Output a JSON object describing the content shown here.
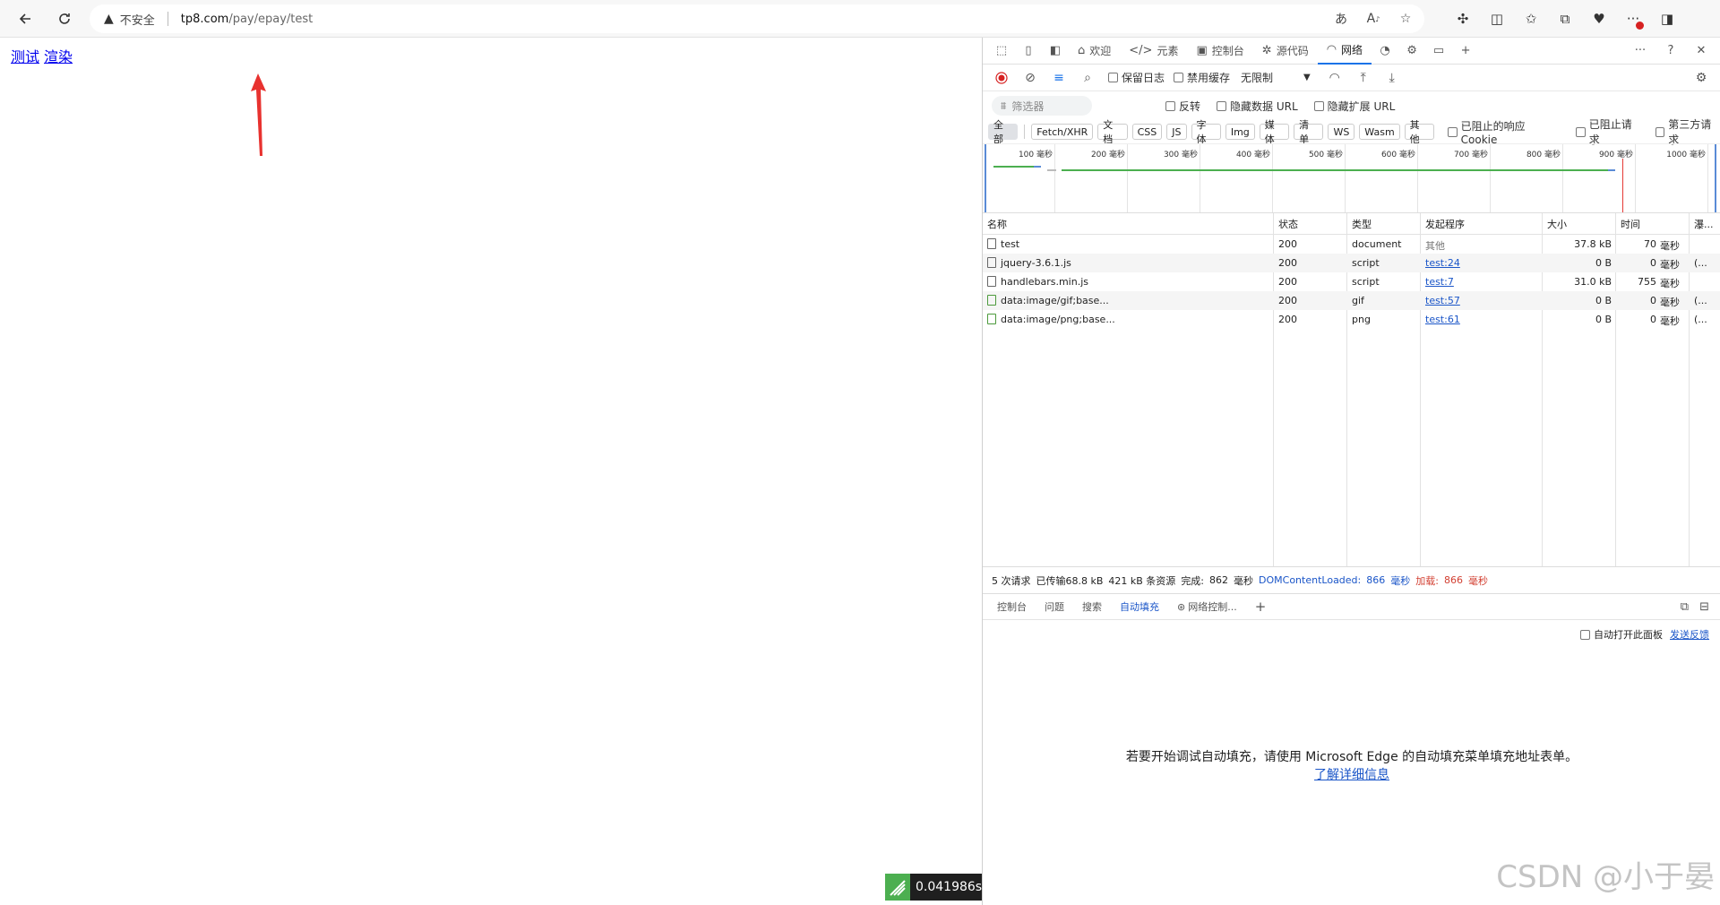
{
  "browser": {
    "insecure_label": "不安全",
    "url_host": "tp8.com",
    "url_path": "/pay/epay/test"
  },
  "page": {
    "links": [
      "测试",
      "渲染"
    ],
    "timer": "0.041986s"
  },
  "devtools": {
    "tabs": [
      {
        "label": "欢迎",
        "icon": "home-icon"
      },
      {
        "label": "元素",
        "icon": "code-icon"
      },
      {
        "label": "控制台",
        "icon": "console-icon"
      },
      {
        "label": "源代码",
        "icon": "bug-icon"
      },
      {
        "label": "网络",
        "icon": "wifi-icon",
        "active": true
      }
    ],
    "network_toolbar": {
      "preserve_log": "保留日志",
      "disable_cache": "禁用缓存",
      "throttle": "无限制"
    },
    "filter": {
      "placeholder": "筛选器",
      "invert": "反转",
      "hide_data_url": "隐藏数据 URL",
      "hide_ext_url": "隐藏扩展 URL"
    },
    "type_filters": [
      "全部",
      "Fetch/XHR",
      "文档",
      "CSS",
      "JS",
      "字体",
      "Img",
      "媒体",
      "清单",
      "WS",
      "Wasm",
      "其他"
    ],
    "type_checks": [
      "已阻止的响应 Cookie",
      "已阻止请求",
      "第三方请求"
    ],
    "overview_ticks": [
      "100 毫秒",
      "200 毫秒",
      "300 毫秒",
      "400 毫秒",
      "500 毫秒",
      "600 毫秒",
      "700 毫秒",
      "800 毫秒",
      "900 毫秒",
      "1000 毫秒"
    ],
    "columns": [
      "名称",
      "状态",
      "类型",
      "发起程序",
      "大小",
      "时间",
      "瀑..."
    ],
    "requests": [
      {
        "name": "test",
        "status": "200",
        "type": "document",
        "initiator": "其他",
        "initiator_link": false,
        "size": "37.8 kB",
        "time": "70",
        "unit": "毫秒",
        "extra": "",
        "icon": "doc"
      },
      {
        "name": "jquery-3.6.1.js",
        "status": "200",
        "type": "script",
        "initiator": "test:24",
        "initiator_link": true,
        "size": "0 B",
        "time": "0",
        "unit": "毫秒",
        "extra": "(...",
        "icon": "script"
      },
      {
        "name": "handlebars.min.js",
        "status": "200",
        "type": "script",
        "initiator": "test:7",
        "initiator_link": true,
        "size": "31.0 kB",
        "time": "755",
        "unit": "毫秒",
        "extra": "",
        "icon": "script"
      },
      {
        "name": "data:image/gif;base...",
        "status": "200",
        "type": "gif",
        "initiator": "test:57",
        "initiator_link": true,
        "size": "0 B",
        "time": "0",
        "unit": "毫秒",
        "extra": "(...",
        "icon": "img"
      },
      {
        "name": "data:image/png;base...",
        "status": "200",
        "type": "png",
        "initiator": "test:61",
        "initiator_link": true,
        "size": "0 B",
        "time": "0",
        "unit": "毫秒",
        "extra": "(...",
        "icon": "img"
      }
    ],
    "status_bar": {
      "requests": "5 次请求",
      "transferred": "已传输68.8 kB",
      "resources": "421 kB 条资源",
      "finish_label": "完成:",
      "finish_value": "862",
      "finish_unit": "毫秒",
      "dcl_label": "DOMContentLoaded:",
      "dcl_value": "866",
      "dcl_unit": "毫秒",
      "load_label": "加载:",
      "load_value": "866",
      "load_unit": "毫秒"
    },
    "drawer_tabs": [
      "控制台",
      "问题",
      "搜索",
      "自动填充",
      "网络控制..."
    ],
    "drawer_active": "自动填充",
    "autofill": {
      "auto_open": "自动打开此面板",
      "feedback": "发送反馈",
      "message": "若要开始调试自动填充，请使用 Microsoft Edge 的自动填充菜单填充地址表单。",
      "learn_more": "了解详细信息"
    }
  },
  "watermark": "CSDN @小于晏"
}
